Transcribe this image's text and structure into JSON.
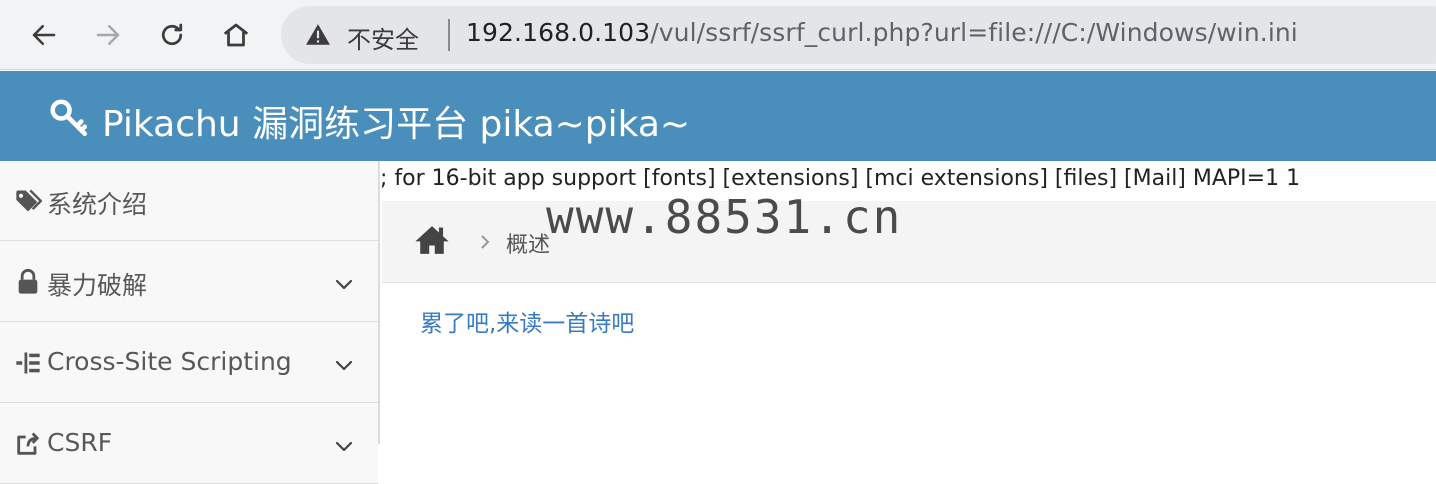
{
  "browser": {
    "security_label": "不安全",
    "url_host": "192.168.0.103",
    "url_path": "/vul/ssrf/ssrf_curl.php?url=file:///C:/Windows/win.ini"
  },
  "header": {
    "title": "Pikachu 漏洞练习平台 pika~pika~",
    "icon": "key-icon"
  },
  "sidebar": {
    "items": [
      {
        "label": "系统介绍",
        "icon": "tags-icon",
        "expandable": false
      },
      {
        "label": "暴力破解",
        "icon": "lock-icon",
        "expandable": true
      },
      {
        "label": "Cross-Site Scripting",
        "icon": "list-icon",
        "expandable": true
      },
      {
        "label": "CSRF",
        "icon": "share-icon",
        "expandable": true
      }
    ]
  },
  "main": {
    "curl_output": "; for 16-bit app support [fonts] [extensions] [mci extensions] [files] [Mail] MAPI=1 1",
    "breadcrumb": {
      "current": "概述"
    },
    "poem_link": "累了吧,来读一首诗吧",
    "watermark": "www.88531.cn"
  },
  "colors": {
    "header_bg": "#4a8fbb",
    "link": "#3a7bc0",
    "sidebar_bg": "#f8f8f8"
  }
}
